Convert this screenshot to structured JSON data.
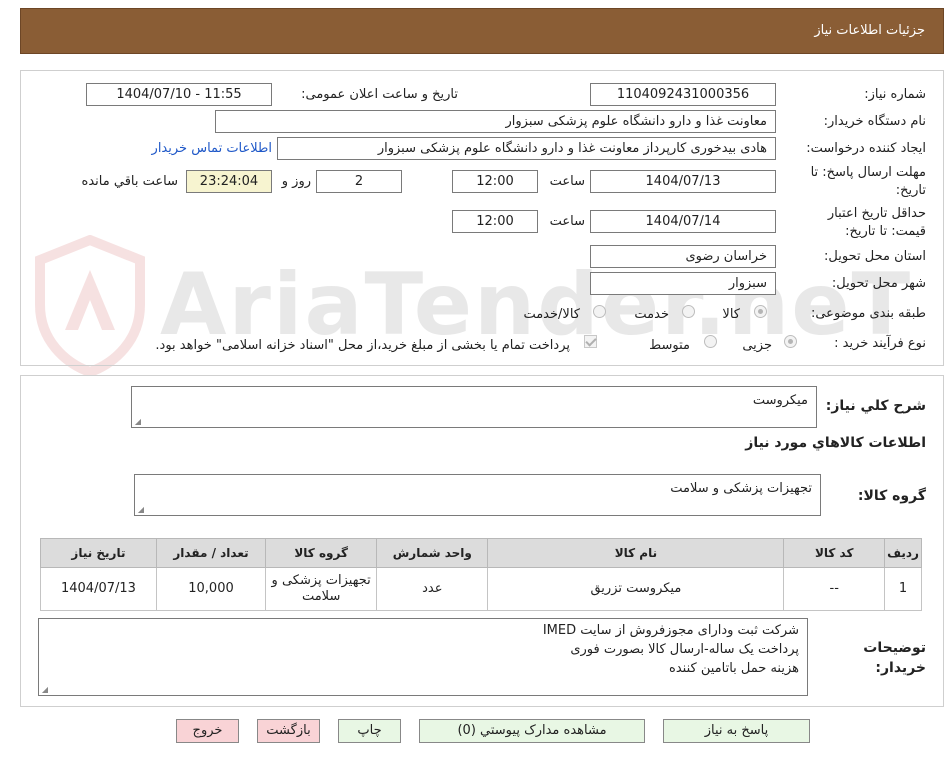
{
  "header": {
    "title": "جزئیات اطلاعات نیاز"
  },
  "watermark": {
    "text": "AriaTender.neT"
  },
  "form": {
    "need_number_label": "شماره نیاز:",
    "need_number": "1104092431000356",
    "announce_label": "تاریخ و ساعت اعلان عمومی:",
    "announce_value": "1404/07/10 - 11:55",
    "buyer_org_label": "نام دستگاه خریدار:",
    "buyer_org": "معاونت غذا و دارو   دانشگاه علوم پزشکی سبزوار",
    "requester_label": "ایجاد کننده درخواست:",
    "requester": "هادی بیدخوری کارپرداز معاونت غذا و دارو   دانشگاه علوم پزشکی سبزوار",
    "contact_link": "اطلاعات تماس خریدار",
    "deadline_label_1": "مهلت ارسال پاسخ: تا",
    "deadline_label_2": "تاریخ:",
    "deadline_date": "1404/07/13",
    "time_label": "ساعت",
    "deadline_time": "12:00",
    "days_value": "2",
    "days_label": "روز و",
    "remaining_time": "23:24:04",
    "remaining_label": "ساعت باقي مانده",
    "validity_label_1": "حداقل تاریخ اعتبار",
    "validity_label_2": "قیمت: تا تاریخ:",
    "validity_date": "1404/07/14",
    "validity_time": "12:00",
    "province_label": "استان محل تحویل:",
    "province": "خراسان رضوی",
    "city_label": "شهر محل تحویل:",
    "city": "سبزوار",
    "category_label": "طبقه بندی موضوعی:",
    "category_options": [
      "کالا",
      "خدمت",
      "کالا/خدمت"
    ],
    "process_label": "نوع فرآیند خرید :",
    "process_options": [
      "جزیی",
      "متوسط"
    ],
    "payment_note": "پرداخت تمام یا بخشی از مبلغ خرید،از محل \"اسناد خزانه اسلامی\" خواهد بود."
  },
  "description": {
    "label": "شرح کلي نياز:",
    "value": "میکروست",
    "items_heading": "اطلاعات کالاهاي مورد نياز",
    "group_label": "گروه کالا:",
    "group_value": "تجهیزات پزشکی و سلامت"
  },
  "table": {
    "headers": [
      "رديف",
      "کد کالا",
      "نام کالا",
      "واحد شمارش",
      "گروه کالا",
      "تعداد / مقدار",
      "تاريخ نياز"
    ],
    "rows": [
      [
        "1",
        "--",
        "میکروست تزریق",
        "عدد",
        "تجهیزات پزشکی و سلامت",
        "10,000",
        "1404/07/13"
      ]
    ]
  },
  "buyer_notes": {
    "label_1": "توضيحات",
    "label_2": "خريدار:",
    "lines": [
      "شرکت ثبت ودارای مجوزفروش از سایت IMED",
      "پرداخت یک ساله-ارسال کالا بصورت فوری",
      "هزینه حمل باتامین کننده"
    ]
  },
  "buttons": {
    "reply": "پاسخ به نياز",
    "attachments": "مشاهده مدارک پيوستي (0)",
    "print": "چاپ",
    "back": "بازگشت",
    "exit": "خروج"
  }
}
